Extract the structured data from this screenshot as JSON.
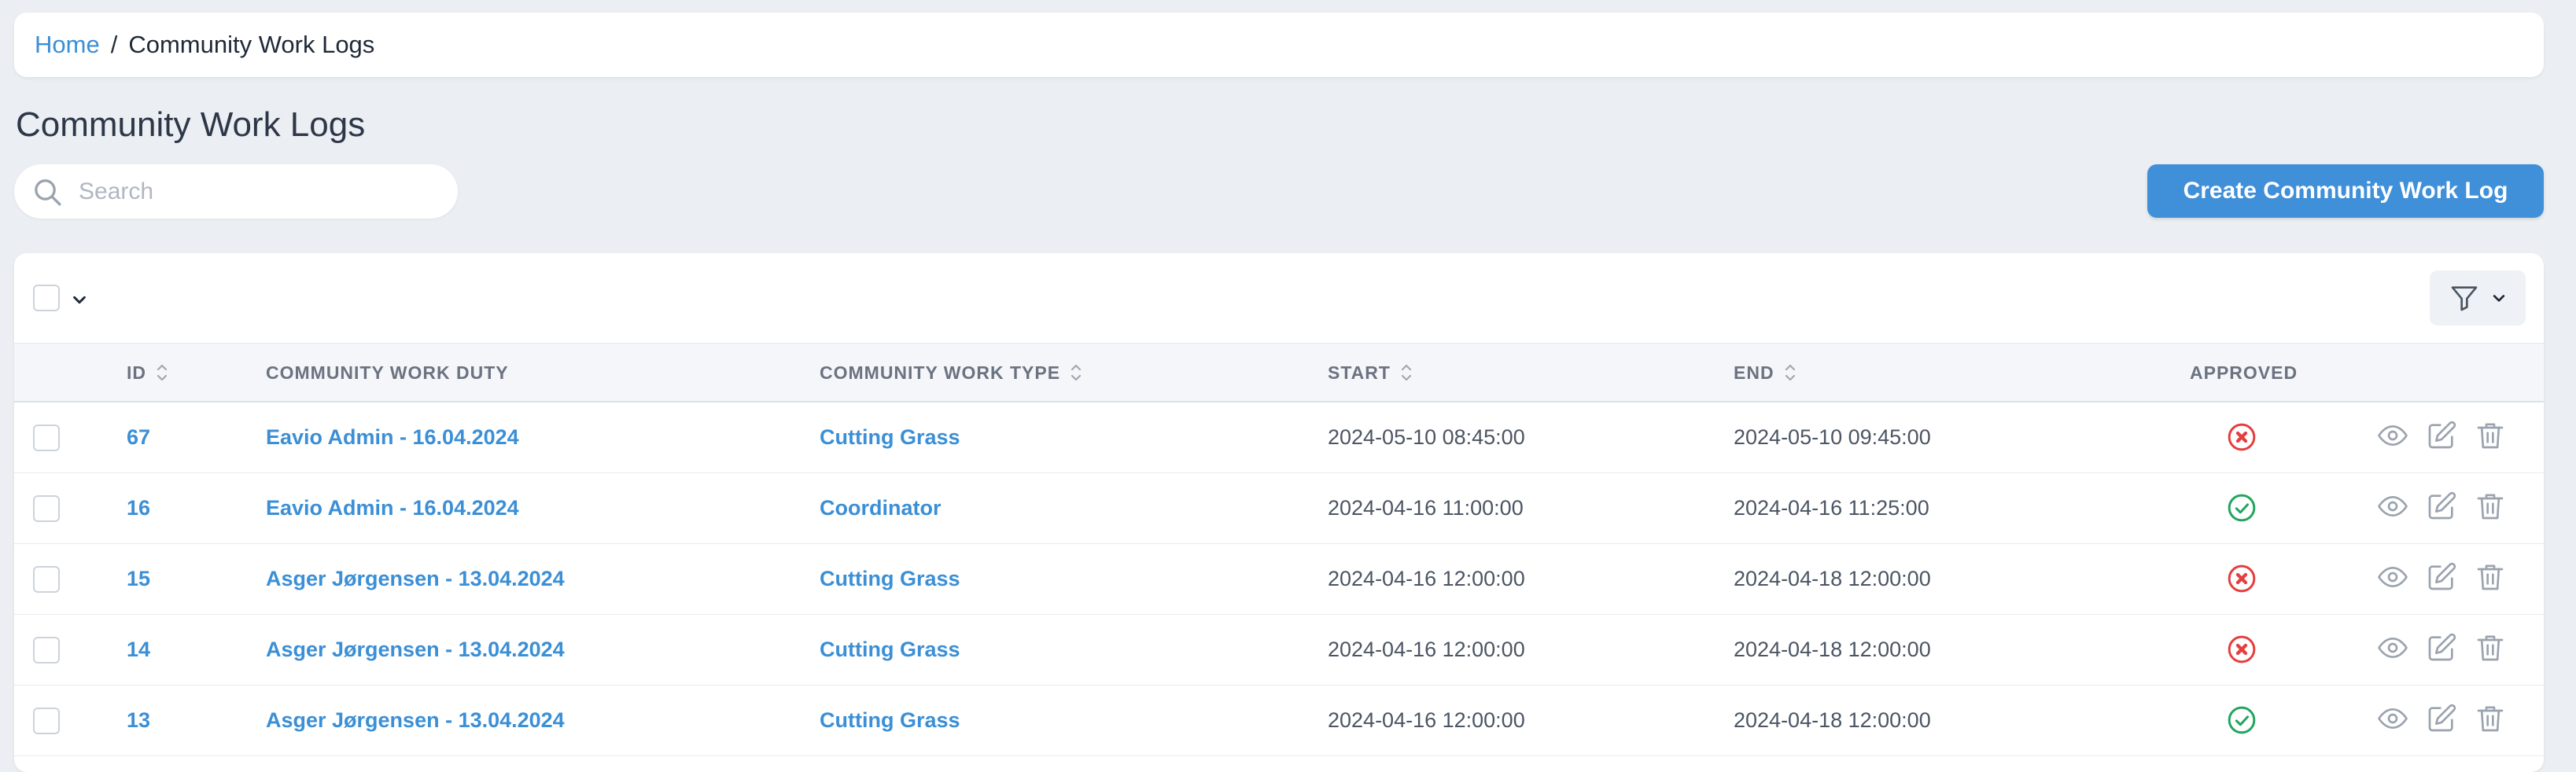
{
  "breadcrumb": {
    "home": "Home",
    "separator": "/",
    "current": "Community Work Logs"
  },
  "page": {
    "title": "Community Work Logs"
  },
  "search": {
    "placeholder": "Search",
    "value": ""
  },
  "toolbar": {
    "create_label": "Create Community Work Log"
  },
  "table": {
    "columns": {
      "id": "ID",
      "duty": "COMMUNITY WORK DUTY",
      "type": "COMMUNITY WORK TYPE",
      "start": "START",
      "end": "END",
      "approved": "APPROVED"
    },
    "rows": [
      {
        "id": "67",
        "duty": "Eavio Admin - 16.04.2024",
        "type": "Cutting Grass",
        "start": "2024-05-10 08:45:00",
        "end": "2024-05-10 09:45:00",
        "approved": false
      },
      {
        "id": "16",
        "duty": "Eavio Admin - 16.04.2024",
        "type": "Coordinator",
        "start": "2024-04-16 11:00:00",
        "end": "2024-04-16 11:25:00",
        "approved": true
      },
      {
        "id": "15",
        "duty": "Asger Jørgensen - 13.04.2024",
        "type": "Cutting Grass",
        "start": "2024-04-16 12:00:00",
        "end": "2024-04-18 12:00:00",
        "approved": false
      },
      {
        "id": "14",
        "duty": "Asger Jørgensen - 13.04.2024",
        "type": "Cutting Grass",
        "start": "2024-04-16 12:00:00",
        "end": "2024-04-18 12:00:00",
        "approved": false
      },
      {
        "id": "13",
        "duty": "Asger Jørgensen - 13.04.2024",
        "type": "Cutting Grass",
        "start": "2024-04-16 12:00:00",
        "end": "2024-04-18 12:00:00",
        "approved": true
      }
    ]
  },
  "colors": {
    "accent": "#3f8fd9",
    "link": "#3b8fd6",
    "approved": "#22a55e",
    "not_approved": "#e53e3e",
    "icon_gray": "#9aa3ae"
  },
  "icons": {
    "search": "search-icon",
    "chevron": "chevron-down-icon",
    "filter": "filter-icon",
    "sort": "sort-icon",
    "view": "eye-icon",
    "edit": "edit-icon",
    "delete": "trash-icon",
    "approved_true": "check-circle-icon",
    "approved_false": "x-circle-icon"
  }
}
